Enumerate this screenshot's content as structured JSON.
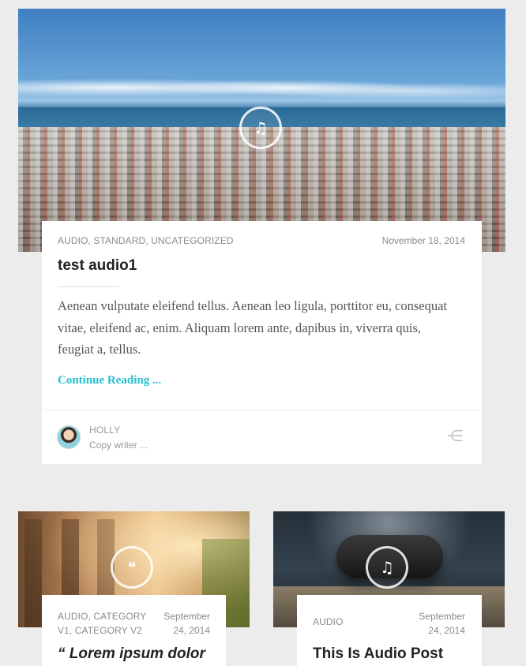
{
  "featured": {
    "icon": "music-note-icon",
    "categories": "AUDIO, STANDARD, UNCATEGORIZED",
    "date": "November 18, 2014",
    "title": "test audio1",
    "excerpt": "Aenean vulputate eleifend tellus. Aenean leo ligula, porttitor eu, consequat vitae, eleifend ac, enim. Aliquam lorem ante, dapibus in, viverra quis, feugiat a, tellus.",
    "continue_label": "Continue Reading ...",
    "author": {
      "name": "HOLLY",
      "role": "Copy writer ..."
    },
    "share_icon": "share-icon"
  },
  "posts": [
    {
      "icon": "quote-icon",
      "icon_glyph": "❝",
      "categories_line1": "AUDIO, CATEGORY",
      "categories_line2": "V1, CATEGORY V2",
      "date_line1": "September",
      "date_line2": "24, 2014",
      "title": "“ Lorem ipsum dolor"
    },
    {
      "icon": "music-note-icon",
      "icon_glyph": "♫",
      "categories": "AUDIO",
      "date_line1": "September",
      "date_line2": "24, 2014",
      "title": "This Is Audio Post"
    }
  ],
  "colors": {
    "page_bg": "#ececec",
    "accent": "#25c1cf",
    "meta_text": "#8a8a8a",
    "title_text": "#222222"
  }
}
